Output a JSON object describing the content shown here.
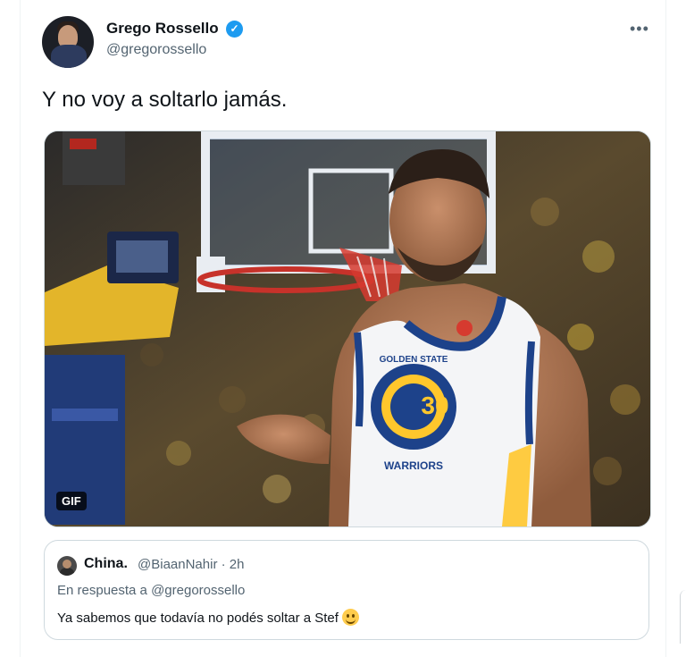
{
  "tweet": {
    "author_name": "Grego Rossello",
    "author_handle": "@gregorossello",
    "verified_glyph": "✓",
    "more_glyph": "•••",
    "text": "Y no voy a soltarlo jamás.",
    "media": {
      "badge": "GIF",
      "jersey_number": "30",
      "jersey_wordmark_top": "GOLDEN STATE",
      "jersey_wordmark_bottom": "WARRIORS"
    }
  },
  "quote": {
    "author_name": "China.",
    "meta": "@BiaanNahir · 2h",
    "reply_context": "En respuesta a @gregorossello",
    "text": "Ya sabemos que todavía no podés soltar a Stef",
    "emoji": "smiling-face-emoji"
  },
  "colors": {
    "accent": "#1d9bf0",
    "text": "#0f1419",
    "secondary": "#536471",
    "border": "#cfd9de"
  }
}
